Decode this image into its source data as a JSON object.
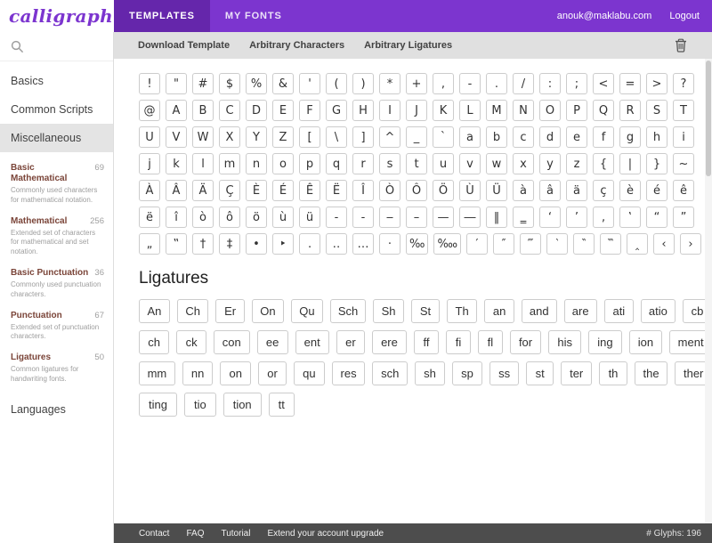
{
  "colors": {
    "brand_purple": "#7c35cf",
    "brand_purple_dark": "#6526ab",
    "toolbar_bg": "#e0e0e0",
    "sidebar_selected_bg": "#e4e4e4",
    "template_name_color": "#7a4438",
    "footer_bg": "#4d4d4d",
    "chip_border": "#cccccc"
  },
  "header": {
    "logo": "calligraphr",
    "tabs": [
      {
        "label": "TEMPLATES",
        "active": true
      },
      {
        "label": "MY FONTS",
        "active": false
      }
    ],
    "account_email": "anouk@maklabu.com",
    "logout_label": "Logout"
  },
  "toolbar": {
    "buttons": [
      "Download Template",
      "Arbitrary Characters",
      "Arbitrary Ligatures"
    ]
  },
  "sidebar": {
    "categories": [
      {
        "label": "Basics",
        "selected": false
      },
      {
        "label": "Common Scripts",
        "selected": false
      },
      {
        "label": "Miscellaneous",
        "selected": true
      }
    ],
    "templates": [
      {
        "name": "Basic Mathematical",
        "count": "69",
        "description": "Commonly used characters for mathematical notation."
      },
      {
        "name": "Mathematical",
        "count": "256",
        "description": "Extended set of characters for mathematical and set notation."
      },
      {
        "name": "Basic Punctuation",
        "count": "36",
        "description": "Commonly used punctuation characters."
      },
      {
        "name": "Punctuation",
        "count": "67",
        "description": "Extended set of punctuation characters."
      },
      {
        "name": "Ligatures",
        "count": "50",
        "description": "Common ligatures for handwriting fonts."
      }
    ],
    "bottom_category": {
      "label": "Languages"
    }
  },
  "content": {
    "char_rows": [
      [
        "!",
        "\"",
        "#",
        "$",
        "%",
        "&",
        "'",
        "(",
        ")",
        "*",
        "+",
        ",",
        "-",
        ".",
        "/",
        ":",
        ";",
        "<",
        "=",
        ">",
        "?"
      ],
      [
        "@",
        "A",
        "B",
        "C",
        "D",
        "E",
        "F",
        "G",
        "H",
        "I",
        "J",
        "K",
        "L",
        "M",
        "N",
        "O",
        "P",
        "Q",
        "R",
        "S",
        "T"
      ],
      [
        "U",
        "V",
        "W",
        "X",
        "Y",
        "Z",
        "[",
        "\\",
        "]",
        "^",
        "_",
        "`",
        "a",
        "b",
        "c",
        "d",
        "e",
        "f",
        "g",
        "h",
        "i"
      ],
      [
        "j",
        "k",
        "l",
        "m",
        "n",
        "o",
        "p",
        "q",
        "r",
        "s",
        "t",
        "u",
        "v",
        "w",
        "x",
        "y",
        "z",
        "{",
        "|",
        "}",
        "~"
      ],
      [
        "À",
        "Â",
        "Ä",
        "Ç",
        "È",
        "É",
        "Ê",
        "Ë",
        "Î",
        "Ò",
        "Ô",
        "Ö",
        "Ù",
        "Ü",
        "à",
        "â",
        "ä",
        "ç",
        "è",
        "é",
        "ê"
      ],
      [
        "ë",
        "î",
        "ò",
        "ô",
        "ö",
        "ù",
        "ü",
        "‐",
        "‑",
        "‒",
        "–",
        "—",
        "―",
        "‖",
        "‗",
        "‘",
        "’",
        "‚",
        "‛",
        "“",
        "”"
      ],
      [
        "„",
        "‟",
        "†",
        "‡",
        "•",
        "‣",
        "․",
        "‥",
        "…",
        "‧",
        "‰",
        "‱",
        "′",
        "″",
        "‴",
        "‵",
        "‶",
        "‷",
        "‸",
        "‹",
        "›"
      ]
    ],
    "ligatures_heading": "Ligatures",
    "ligature_rows": [
      [
        "An",
        "Ch",
        "Er",
        "On",
        "Qu",
        "Sch",
        "Sh",
        "St",
        "Th",
        "an",
        "and",
        "are",
        "ati",
        "atio",
        "cb"
      ],
      [
        "ch",
        "ck",
        "con",
        "ee",
        "ent",
        "er",
        "ere",
        "ff",
        "fi",
        "fl",
        "for",
        "his",
        "ing",
        "ion",
        "ment"
      ],
      [
        "mm",
        "nn",
        "on",
        "or",
        "qu",
        "res",
        "sch",
        "sh",
        "sp",
        "ss",
        "st",
        "ter",
        "th",
        "the",
        "ther"
      ],
      [
        "ting",
        "tio",
        "tion",
        "tt"
      ]
    ]
  },
  "footer": {
    "links": [
      "Contact",
      "FAQ",
      "Tutorial",
      "Extend your account upgrade"
    ],
    "glyph_count": "# Glyphs: 196"
  }
}
